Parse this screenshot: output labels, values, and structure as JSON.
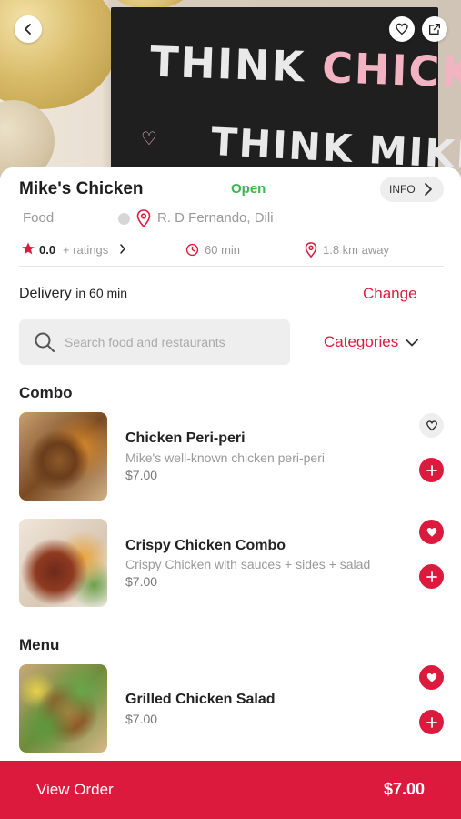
{
  "hero": {
    "board_line1_a": "THINK",
    "board_line1_b": "CHICKEN",
    "board_line2": "THINK MIKE'S"
  },
  "restaurant": {
    "name": "Mike's Chicken",
    "status": "Open",
    "info_label": "INFO",
    "category": "Food",
    "location": "R. D Fernando, Dili",
    "rating": "0.0",
    "ratings_label": "+ ratings",
    "time": "60 min",
    "distance": "1.8 km away"
  },
  "delivery": {
    "label": "Delivery",
    "eta": "in 60 min",
    "change_label": "Change"
  },
  "search": {
    "placeholder": "Search food and restaurants",
    "categories_label": "Categories"
  },
  "sections": {
    "combo": {
      "title": "Combo",
      "items": [
        {
          "name": "Chicken Peri-peri",
          "description": "Mike's well-known chicken peri-peri",
          "price": "$7.00",
          "favorited": false
        },
        {
          "name": "Crispy Chicken Combo",
          "description": "Crispy Chicken with sauces + sides + salad",
          "price": "$7.00",
          "favorited": true
        }
      ]
    },
    "menu": {
      "title": "Menu",
      "items": [
        {
          "name": "Grilled Chicken Salad",
          "price": "$7.00",
          "favorited": true
        }
      ]
    }
  },
  "order": {
    "label": "View Order",
    "total": "$7.00"
  },
  "colors": {
    "accent": "#dc1a3d",
    "open": "#3cb54a"
  }
}
